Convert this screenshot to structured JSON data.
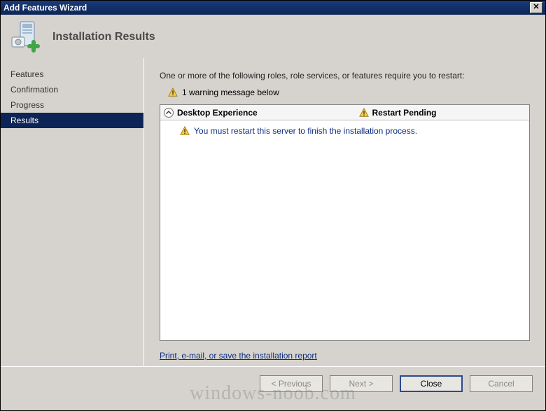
{
  "window": {
    "title": "Add Features Wizard",
    "close_glyph": "✕"
  },
  "header": {
    "title": "Installation Results"
  },
  "sidebar": {
    "items": [
      {
        "label": "Features"
      },
      {
        "label": "Confirmation"
      },
      {
        "label": "Progress"
      },
      {
        "label": "Results"
      }
    ],
    "selected_index": 3
  },
  "main": {
    "intro": "One or more of the following roles, role services, or features require you to restart:",
    "warning_summary": "1 warning message below",
    "panel": {
      "feature": "Desktop Experience",
      "status": "Restart Pending",
      "message": "You must restart this server to finish the installation process."
    },
    "report_link": "Print, e-mail, or save the installation report"
  },
  "footer": {
    "previous": "< Previous",
    "next": "Next >",
    "close": "Close",
    "cancel": "Cancel"
  },
  "watermark": "windows-noob.com"
}
